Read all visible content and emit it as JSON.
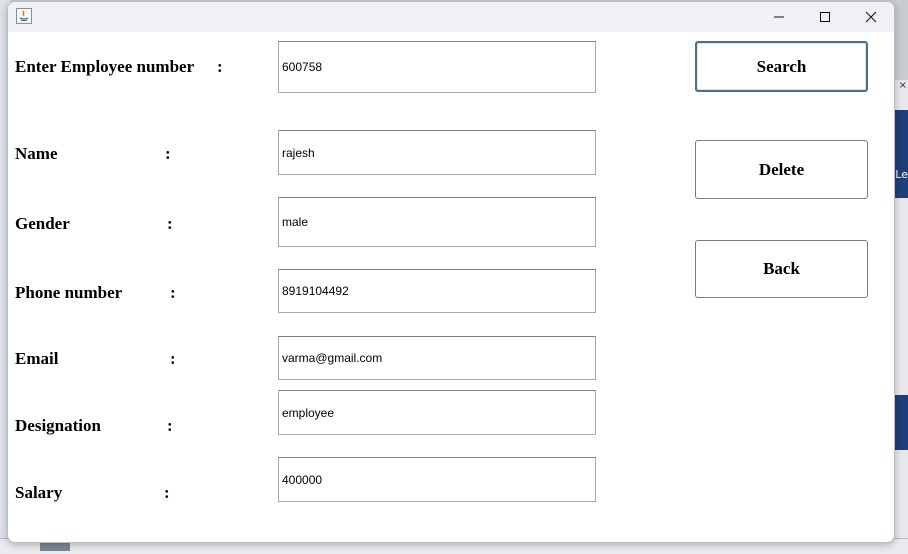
{
  "window": {
    "controls": {
      "minimize": "minimize-icon",
      "maximize": "maximize-icon",
      "close": "close-icon"
    }
  },
  "form": {
    "employee_number": {
      "label": "Enter Employee number",
      "colon": ":",
      "value": "600758"
    },
    "name": {
      "label": "Name",
      "colon": ":",
      "value": "rajesh"
    },
    "gender": {
      "label": "Gender",
      "colon": ":",
      "value": "male"
    },
    "phone": {
      "label": "Phone number",
      "colon": ":",
      "value": "8919104492"
    },
    "email": {
      "label": "Email",
      "colon": ":",
      "value": "varma@gmail.com"
    },
    "designation": {
      "label": "Designation",
      "colon": ":",
      "value": "employee"
    },
    "salary": {
      "label": "Salary",
      "colon": ":",
      "value": "400000"
    }
  },
  "buttons": {
    "search": "Search",
    "delete": "Delete",
    "back": "Back"
  },
  "background": {
    "tab_close": "×",
    "side_label": "Le"
  },
  "colors": {
    "titlebar": "#eff1f5",
    "window": "#ffffff",
    "search_border": "#4a6e96",
    "ide_blue": "#1f3f7a"
  }
}
